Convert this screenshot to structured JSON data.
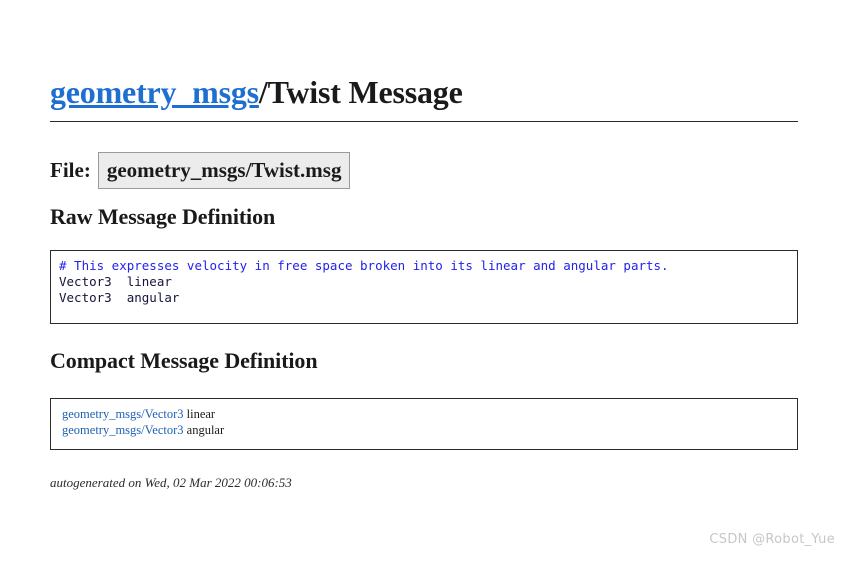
{
  "document": {
    "title": {
      "link_text": "geometry_msgs",
      "suffix_text": "/Twist Message"
    },
    "file": {
      "label": "File:",
      "value": "geometry_msgs/Twist.msg"
    },
    "sections": {
      "raw": {
        "heading": "Raw Message Definition",
        "comment_line": "# This expresses velocity in free space broken into its linear and angular parts.",
        "body_lines": "Vector3  linear\nVector3  angular"
      },
      "compact": {
        "heading": "Compact Message Definition",
        "rows": [
          {
            "type_link": "geometry_msgs/Vector3",
            "field": " linear"
          },
          {
            "type_link": "geometry_msgs/Vector3",
            "field": " angular"
          }
        ]
      }
    },
    "footer": {
      "autogenerated": "autogenerated on Wed, 02 Mar 2022 00:06:53"
    },
    "watermark": {
      "text": "CSDN @Robot_Yue"
    },
    "colors": {
      "title_link": "#1f6fd0",
      "comment_blue": "#2222ee",
      "compact_link": "#2061b5",
      "code_text": "#14143c",
      "file_box_bg": "#ececec",
      "border": "#2b2b2b",
      "watermark": "#c7c7c7"
    }
  }
}
